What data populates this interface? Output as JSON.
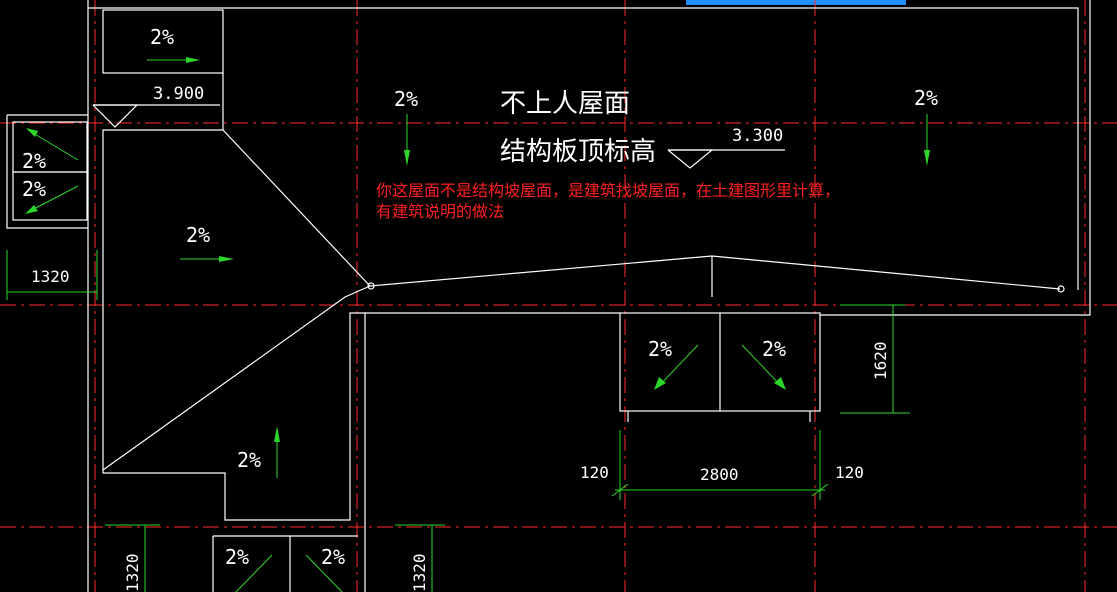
{
  "slope_label": "2%",
  "roof": {
    "title": "不上人屋面",
    "subtitle": "结构板顶标高",
    "level_main": "3.300",
    "level_upper": "3.900"
  },
  "note": {
    "line1": "你这屋面不是结构坡屋面，是建筑找坡屋面，在土建图形里计算，",
    "line2": "有建筑说明的做法"
  },
  "dimensions": {
    "left_width": "1320",
    "bottom_left": "1320",
    "bottom_right": "1320",
    "vertical_right": "1620",
    "span": "2800",
    "side_left": "120",
    "side_right": "120"
  },
  "colors": {
    "background": "#000000",
    "wall": "#ffffff",
    "axis": "#ff2a2a",
    "dimension": "#2bd62b",
    "note": "#ff2020",
    "selection_bar": "#1e90ff"
  }
}
